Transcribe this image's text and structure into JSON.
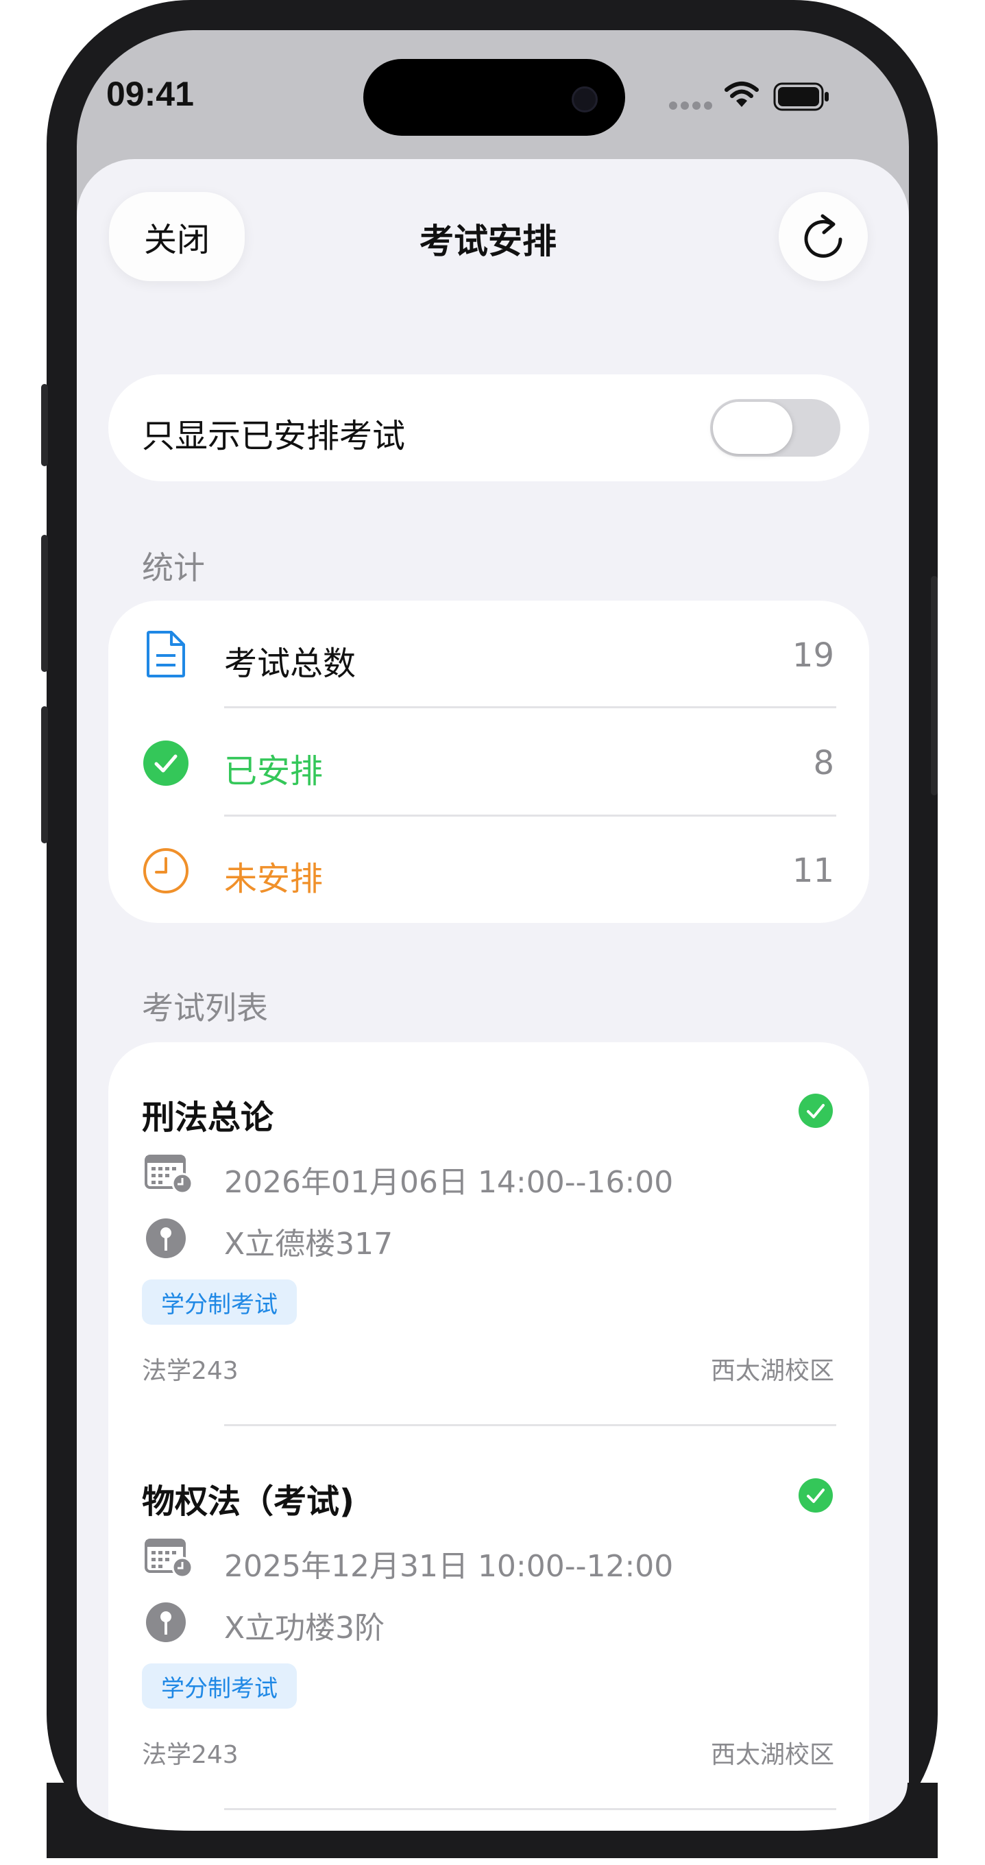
{
  "status_bar": {
    "time": "09:41"
  },
  "nav": {
    "close_label": "关闭",
    "title": "考试安排",
    "refresh_icon": "arrow-clockwise-icon"
  },
  "filter": {
    "label": "只显示已安排考试",
    "enabled": false
  },
  "stats": {
    "section_title": "统计",
    "rows": [
      {
        "icon": "document-icon",
        "label": "考试总数",
        "value": "19",
        "color": "#111111",
        "icon_color": "#1f88e5"
      },
      {
        "icon": "checkmark-circle-icon",
        "label": "已安排",
        "value": "8",
        "color": "#34c759",
        "icon_color": "#34c759"
      },
      {
        "icon": "clock-icon",
        "label": "未安排",
        "value": "11",
        "color": "#f0902a",
        "icon_color": "#f0902a"
      }
    ]
  },
  "exams": {
    "section_title": "考试列表",
    "items": [
      {
        "name": "刑法总论",
        "scheduled": true,
        "datetime": "2026年01月06日 14:00--16:00",
        "location": "X立德楼317",
        "tag": "学分制考试",
        "class": "法学243",
        "campus": "西太湖校区"
      },
      {
        "name": "物权法（考试)",
        "scheduled": true,
        "datetime": "2025年12月31日 10:00--12:00",
        "location": "X立功楼3阶",
        "tag": "学分制考试",
        "class": "法学243",
        "campus": "西太湖校区"
      }
    ]
  },
  "colors": {
    "accent_blue": "#1f88e5",
    "success_green": "#34c759",
    "warning_orange": "#f0902a",
    "background": "#f2f2f7"
  }
}
